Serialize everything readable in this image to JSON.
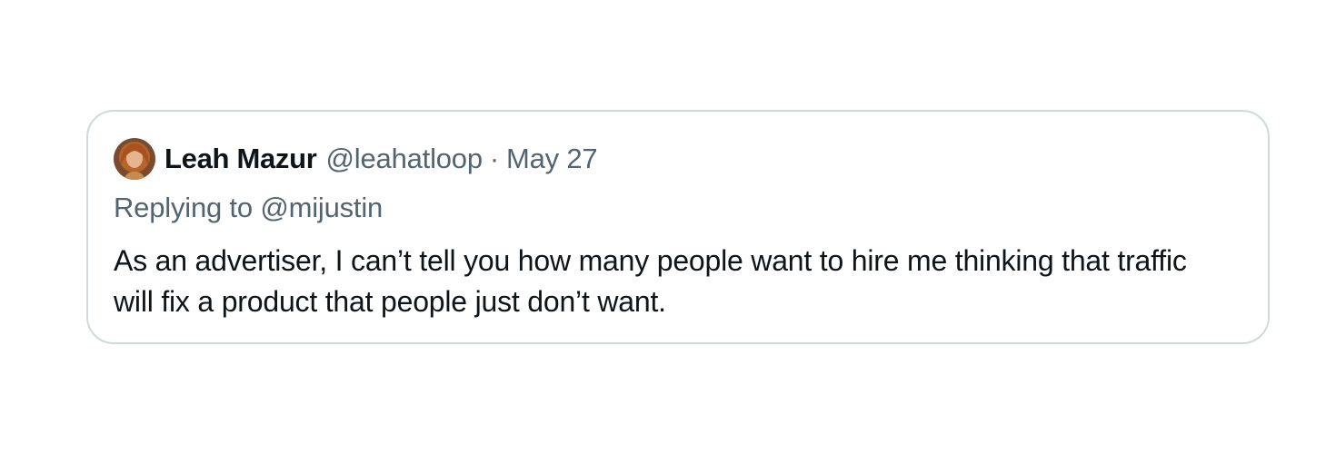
{
  "tweet": {
    "author": {
      "display_name": "Leah Mazur",
      "handle": "@leahatloop",
      "avatar_icon": "profile-photo-icon"
    },
    "separator": "·",
    "date": "May 27",
    "reply": {
      "prefix": "Replying to ",
      "mention": "@mijustin"
    },
    "text": "As an advertiser, I can’t tell you how many people want to hire me thinking that traffic will fix a product that people just don’t want."
  },
  "colors": {
    "border": "#cfd9de",
    "primary_text": "#0f1419",
    "secondary_text": "#536471",
    "avatar_hair": "#b5652a",
    "avatar_bg": "#8a5a3a"
  }
}
